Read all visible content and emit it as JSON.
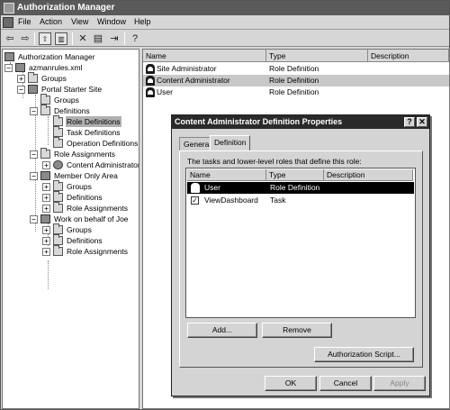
{
  "window": {
    "title": "Authorization Manager"
  },
  "menu": [
    "File",
    "Action",
    "View",
    "Window",
    "Help"
  ],
  "toolbar": {
    "icons": [
      "back-arrow-icon",
      "forward-arrow-icon",
      "up-folder-icon",
      "show-hide-tree-icon",
      "delete-icon",
      "properties-icon",
      "export-list-icon",
      "help-icon"
    ]
  },
  "tree": {
    "root": "Authorization Manager",
    "store": "azmanrules.xml",
    "nodes": [
      "Groups",
      "Portal Starter Site",
      "Groups",
      "Definitions",
      "Role Definitions",
      "Task Definitions",
      "Operation Definitions",
      "Role Assignments",
      "Content Administrator",
      "Member Only Area",
      "Groups",
      "Definitions",
      "Role Assignments",
      "Work on behalf of Joe",
      "Groups",
      "Definitions",
      "Role Assignments"
    ]
  },
  "list": {
    "columns": [
      "Name",
      "Type",
      "Description"
    ],
    "rows": [
      {
        "name": "Site Administrator",
        "type": "Role Definition"
      },
      {
        "name": "Content Administrator",
        "type": "Role Definition"
      },
      {
        "name": "User",
        "type": "Role Definition"
      }
    ]
  },
  "dialog": {
    "title": "Content Administrator Definition Properties",
    "help": "?",
    "close": "✕",
    "tabs": [
      "General",
      "Definition"
    ],
    "caption": "The tasks and lower-level roles that define this role:",
    "columns": [
      "Name",
      "Type",
      "Description"
    ],
    "rows": [
      {
        "name": "User",
        "type": "Role Definition"
      },
      {
        "name": "ViewDashboard",
        "type": "Task"
      }
    ],
    "buttons": {
      "add": "Add...",
      "remove": "Remove",
      "script": "Authorization Script...",
      "ok": "OK",
      "cancel": "Cancel",
      "apply": "Apply"
    }
  },
  "colors": {
    "titlebar": "#5a5a5a",
    "dialog_titlebar": "#2a2a2a",
    "selected_row": "#000000"
  }
}
